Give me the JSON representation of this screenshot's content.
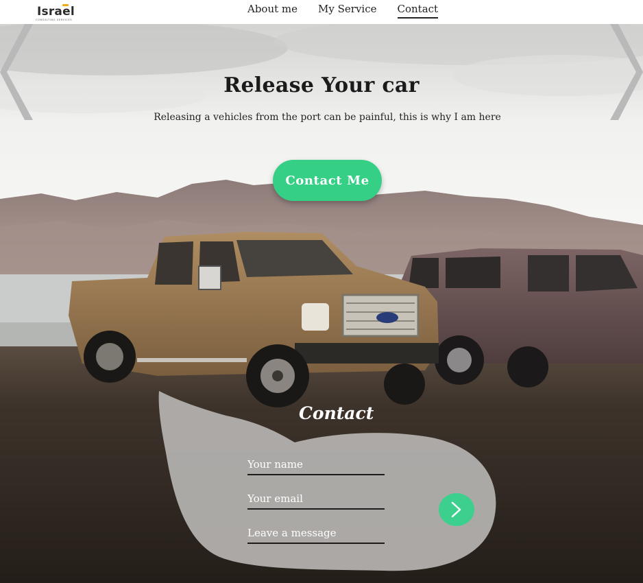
{
  "logo": {
    "name": "Israel",
    "tagline": "CONSULTING SERVICES",
    "accent_color": "#f2a90f"
  },
  "nav": {
    "items": [
      {
        "label": "About me",
        "active": false
      },
      {
        "label": "My Service",
        "active": false
      },
      {
        "label": "Contact",
        "active": true
      }
    ]
  },
  "hero": {
    "title": "Release Your car",
    "subtitle": "Releasing a vehicles from the port can be painful, this is why I am here",
    "cta_label": "Contact Me",
    "cta_color": "#36cf86"
  },
  "contact": {
    "heading": "Contact",
    "name_placeholder": "Your name",
    "email_placeholder": "Your email",
    "message_placeholder": "Leave a message",
    "submit_icon": "chevron-right-icon",
    "submit_color": "#3dcf8e"
  },
  "carousel": {
    "prev_icon": "chevron-left-icon",
    "next_icon": "chevron-right-icon"
  }
}
